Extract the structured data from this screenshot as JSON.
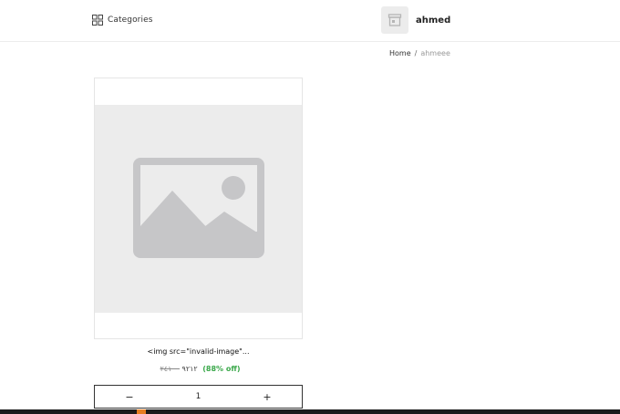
{
  "header": {
    "categories_label": "Categories",
    "store_name": "ahmed"
  },
  "breadcrumb": {
    "home": "Home",
    "separator": "/",
    "current": "ahmeee"
  },
  "product": {
    "title": "<img src=\"invalid-image\"...",
    "price_current": "٩٢١٢",
    "price_original": "٢٤١٠٠",
    "discount": "(88% off)",
    "quantity": "1",
    "minus_label": "−",
    "plus_label": "+"
  },
  "colors": {
    "discount": "#3aa84a",
    "placeholder_bg": "#ececec",
    "placeholder_icon": "#c6c6c8"
  },
  "icons": {
    "categories": "grid-icon",
    "store": "store-icon",
    "image": "image-placeholder-icon"
  }
}
